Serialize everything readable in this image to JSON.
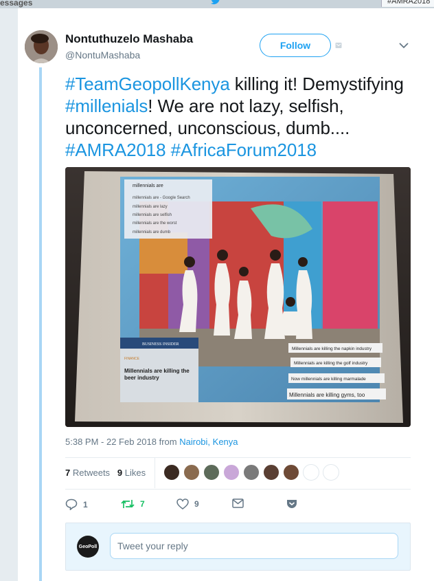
{
  "topbar": {
    "messages_label": "essages",
    "search_value": "#AMRA2018"
  },
  "author": {
    "name": "Nontuthuzelo Mashaba",
    "handle": "@NontuMashaba"
  },
  "follow_label": "Follow",
  "tweet": {
    "parts": [
      {
        "text": "#TeamGeopollKenya",
        "hashtag": true
      },
      {
        "text": " killing it! Demystifying ",
        "hashtag": false
      },
      {
        "text": "#millenials",
        "hashtag": true
      },
      {
        "text": "! We are not lazy, selfish, unconcerned, unconscious, dumb.... ",
        "hashtag": false
      },
      {
        "text": "#AMRA2018",
        "hashtag": true
      },
      {
        "text": " ",
        "hashtag": false
      },
      {
        "text": "#AfricaForum2018",
        "hashtag": true
      }
    ]
  },
  "photo": {
    "search_query": "millennials are",
    "suggestions": [
      "millennials are - Google Search",
      "millennials are lazy",
      "millennials are selfish",
      "millennials are the worst",
      "millennials are dumb"
    ],
    "business_insider": "BUSINESS INSIDER",
    "bi_tag": "FINANCE",
    "bi_headline": "Millennials are killing the beer industry",
    "headlines": [
      "Millennials are killing the napkin industry",
      "Millennials are killing the golf industry",
      "Now millennials are killing marmalade",
      "Millennials are killing gyms, too"
    ]
  },
  "meta": {
    "time": "5:38 PM - 22 Feb 2018",
    "from": "from",
    "location": "Nairobi, Kenya"
  },
  "stats": {
    "retweets_count": "7",
    "retweets_label": "Retweets",
    "likes_count": "9",
    "likes_label": "Likes"
  },
  "likers": [
    "#3b2a22",
    "#8a6b4f",
    "#5d6b5a",
    "#c9a7d8",
    "#7a7a7a",
    "#5a3f33",
    "#6e4a36",
    "#ffffff",
    "#ffffff"
  ],
  "actions": {
    "reply_count": "1",
    "retweet_count": "7",
    "like_count": "9"
  },
  "reply": {
    "avatar_label": "GeoPoll",
    "placeholder": "Tweet your reply"
  },
  "colors": {
    "brand": "#1da1f2",
    "hashtag": "#1b95e0",
    "retweet": "#17bf63"
  }
}
